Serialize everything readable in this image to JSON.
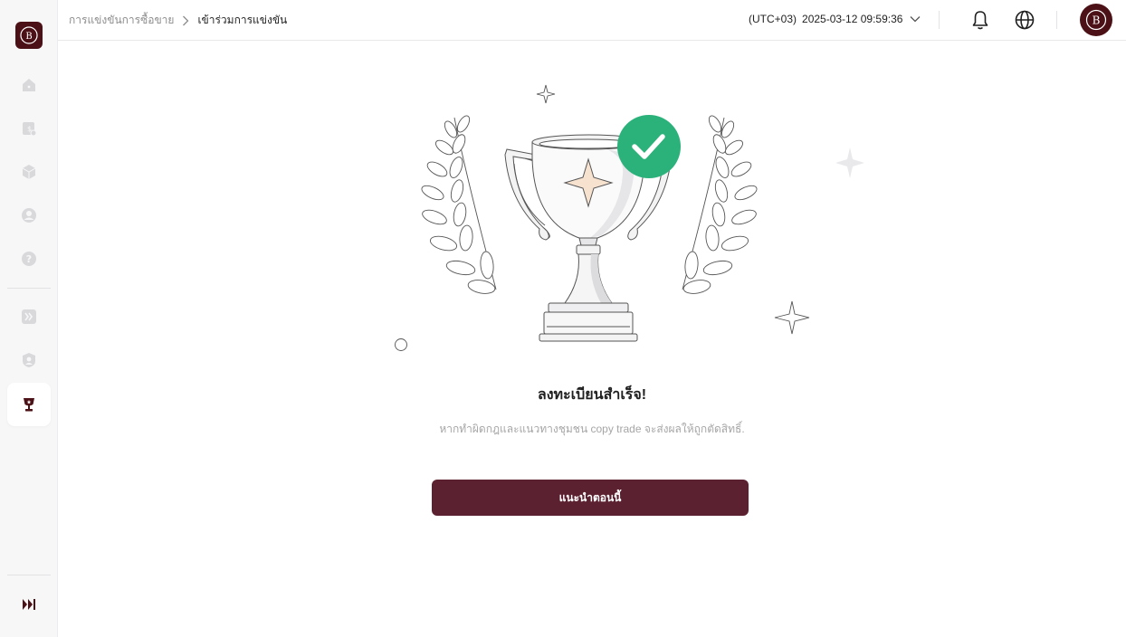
{
  "app": {
    "logo_icon": "brand-logo-icon",
    "brand_color": "#4b1116",
    "accent_color": "#5c2130"
  },
  "sidebar": {
    "items": [
      {
        "id": "home",
        "icon": "home-icon"
      },
      {
        "id": "assets",
        "icon": "wallet-icon"
      },
      {
        "id": "products",
        "icon": "cube-icon"
      },
      {
        "id": "account",
        "icon": "user-icon"
      },
      {
        "id": "help",
        "icon": "question-icon"
      },
      {
        "id": "copy-trade",
        "icon": "forward-icon"
      },
      {
        "id": "profile-shield",
        "icon": "shield-user-icon"
      },
      {
        "id": "competition",
        "icon": "trophy-icon",
        "active": true
      }
    ],
    "collapse_icon": "collapse-sidebar-icon"
  },
  "header": {
    "breadcrumb": {
      "previous": "การแข่งขันการซื้อขาย",
      "current": "เข้าร่วมการแข่งขัน"
    },
    "timezone": "(UTC+03)",
    "datetime": "2025-03-12 09:59:36",
    "icons": [
      "bell-icon",
      "globe-icon"
    ],
    "avatar_icon": "user-avatar"
  },
  "main": {
    "status_icon": "check-circle-icon",
    "status_color": "#2bb17a",
    "title": "ลงทะเบียนสำเร็จ!",
    "description": "หากทำผิดกฎและแนวทางชุมชน copy trade จะส่งผลให้ถูกตัดสิทธิ์.",
    "button_label": "แนะนำตอนนี้"
  }
}
